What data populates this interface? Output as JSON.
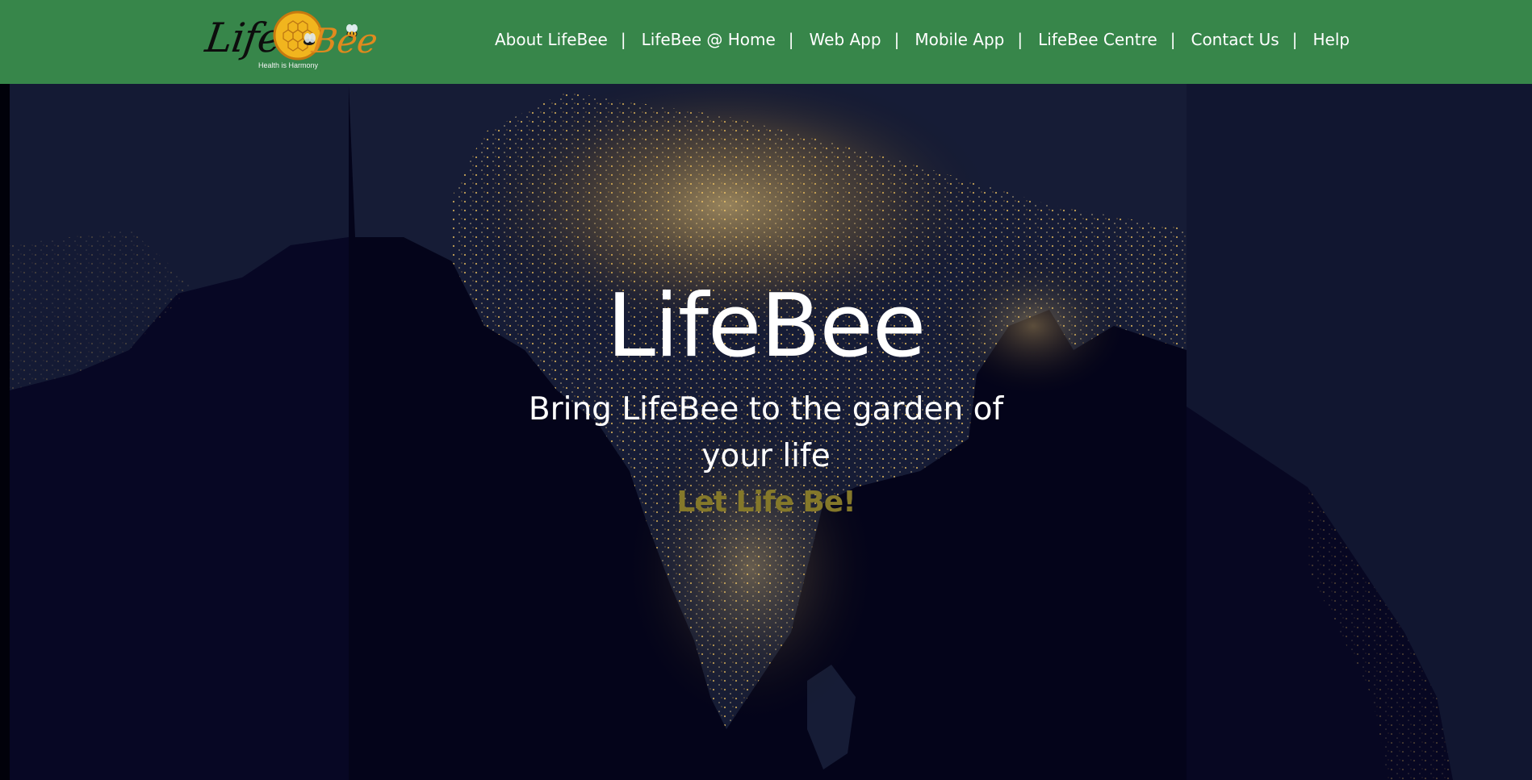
{
  "header": {
    "logo": {
      "word_life": "Life",
      "word_bee": "Bee",
      "tagline": "Health is Harmony"
    },
    "nav": [
      {
        "label": "About LifeBee"
      },
      {
        "label": "LifeBee @ Home"
      },
      {
        "label": "Web App"
      },
      {
        "label": "Mobile App"
      },
      {
        "label": "LifeBee Centre"
      },
      {
        "label": "Contact Us"
      },
      {
        "label": "Help"
      }
    ],
    "separator": "|"
  },
  "hero": {
    "title": "LifeBee",
    "subtitle": "Bring LifeBee to the garden of your life",
    "slogan": "Let Life Be!"
  },
  "colors": {
    "header_bg": "#37864a",
    "hero_bg": "#03030f",
    "city_lights": "#ffd67a",
    "slogan": "#84782a",
    "logo_bee": "#e08a1e"
  }
}
